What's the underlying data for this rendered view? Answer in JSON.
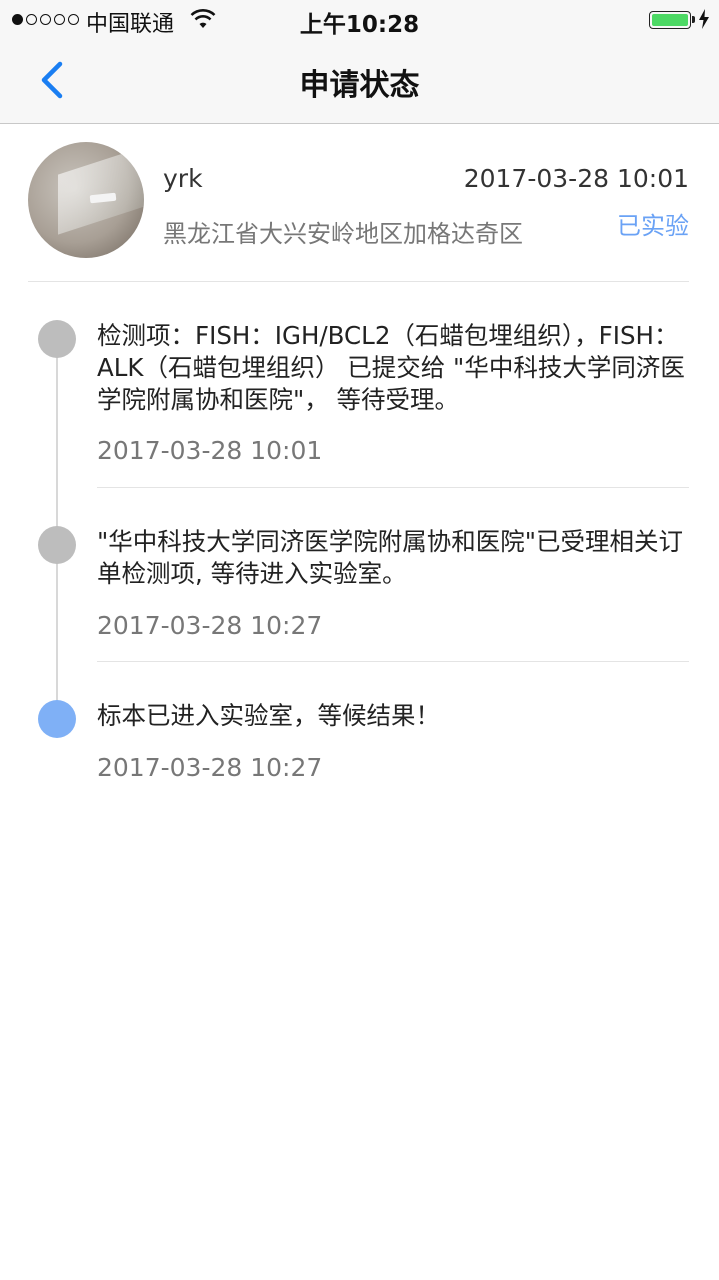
{
  "status_bar": {
    "carrier": "中国联通",
    "time": "上午10:28",
    "signal_bars_filled": 1,
    "signal_bars_total": 5,
    "battery_level": 1.0
  },
  "nav": {
    "title": "申请状态",
    "back_icon": "chevron-left-icon"
  },
  "request": {
    "username": "yrk",
    "time": "2017-03-28 10:01",
    "location": "黑龙江省大兴安岭地区加格达奇区",
    "status": "已实验"
  },
  "timeline": [
    {
      "message": "检测项：FISH：IGH/BCL2（石蜡包埋组织），FISH：ALK（石蜡包埋组织） 已提交给 \"华中科技大学同济医学院附属协和医院\"， 等待受理。",
      "time": "2017-03-28 10:01",
      "current": false
    },
    {
      "message": "\"华中科技大学同济医学院附属协和医院\"已受理相关订单检测项, 等待进入实验室。",
      "time": "2017-03-28 10:27",
      "current": false
    },
    {
      "message": "标本已进入实验室，等候结果！",
      "time": "2017-03-28 10:27",
      "current": true
    }
  ],
  "colors": {
    "accent": "#1a7ef2",
    "status_text": "#6aa2f5",
    "node_done": "#bdbdbd",
    "node_current": "#7fb0f6",
    "battery": "#4cd964"
  }
}
